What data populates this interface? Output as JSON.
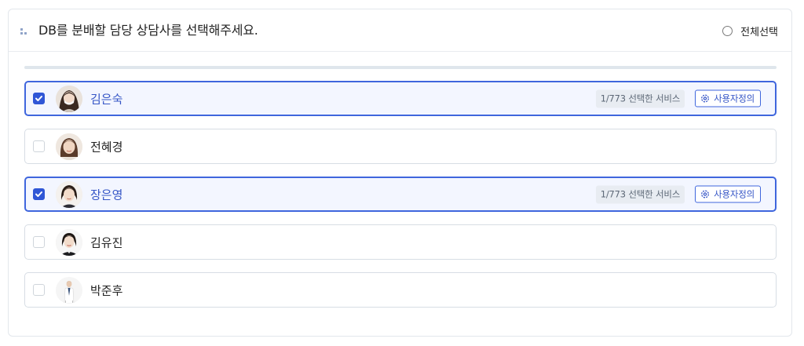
{
  "header": {
    "title": "DB를 분배할 담당 상담사를 선택해주세요.",
    "select_all_label": "전체선택",
    "select_all_checked": false
  },
  "progress": 0,
  "counselors": [
    {
      "name": "김은숙",
      "selected": true,
      "service_badge": "1/773 선택한 서비스",
      "custom_label": "사용자정의",
      "avatar": "avatar-woman-mask"
    },
    {
      "name": "전혜경",
      "selected": false,
      "avatar": "avatar-woman"
    },
    {
      "name": "장은영",
      "selected": true,
      "service_badge": "1/773 선택한 서비스",
      "custom_label": "사용자정의",
      "avatar": "avatar-woman-shorthair"
    },
    {
      "name": "김유진",
      "selected": false,
      "avatar": "avatar-woman-suit"
    },
    {
      "name": "박준후",
      "selected": false,
      "avatar": "avatar-man-doctor"
    }
  ],
  "colors": {
    "accent": "#3f66dd",
    "selected_bg": "#f3f6ff",
    "badge_bg": "#e8ecf2"
  }
}
